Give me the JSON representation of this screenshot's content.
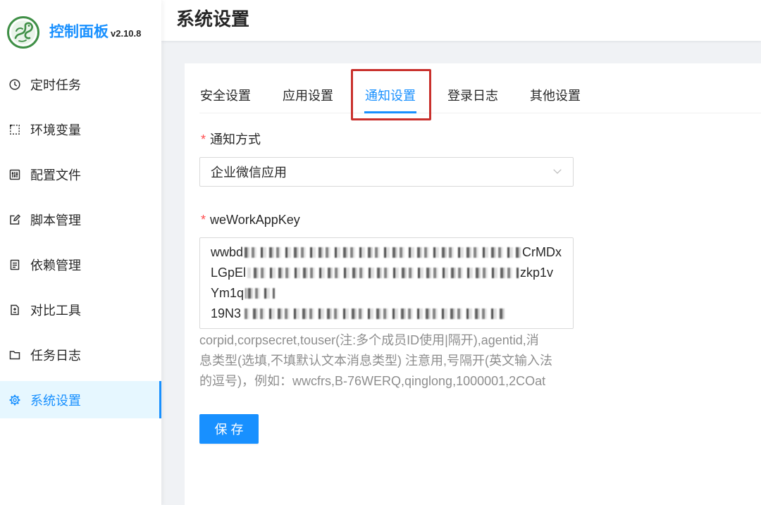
{
  "app": {
    "name": "控制面板",
    "version": "v2.10.8",
    "logo_icon": "dragon-logo-icon"
  },
  "colors": {
    "primary": "#1890ff",
    "selected_bg": "#e6f7ff",
    "page_bg": "#f0f2f5",
    "highlight": "#c9302c",
    "required": "#ff4d4f"
  },
  "sidebar": {
    "items": [
      {
        "label": "定时任务",
        "icon": "clock-icon",
        "selected": false
      },
      {
        "label": "环境变量",
        "icon": "dashed-box-icon",
        "selected": false
      },
      {
        "label": "配置文件",
        "icon": "control-panel-icon",
        "selected": false
      },
      {
        "label": "脚本管理",
        "icon": "edit-icon",
        "selected": false
      },
      {
        "label": "依赖管理",
        "icon": "file-text-icon",
        "selected": false
      },
      {
        "label": "对比工具",
        "icon": "diff-icon",
        "selected": false
      },
      {
        "label": "任务日志",
        "icon": "folder-icon",
        "selected": false
      },
      {
        "label": "系统设置",
        "icon": "gear-icon",
        "selected": true
      }
    ]
  },
  "header": {
    "title": "系统设置"
  },
  "settings": {
    "tabs": [
      {
        "label": "安全设置",
        "active": false
      },
      {
        "label": "应用设置",
        "active": false
      },
      {
        "label": "通知设置",
        "active": true,
        "annotated": true
      },
      {
        "label": "登录日志",
        "active": false
      },
      {
        "label": "其他设置",
        "active": false
      }
    ],
    "form": {
      "notify_type": {
        "required_mark": "*",
        "label": "通知方式",
        "value": "企业微信应用",
        "icon": "chevron-down-icon"
      },
      "app_key": {
        "required_mark": "*",
        "label": "weWorkAppKey",
        "value_lines": [
          {
            "start": "wwbd",
            "redacted": true,
            "end": "CrMDx"
          },
          {
            "start": "LGpEl",
            "redacted": true,
            "end": "zkp1v"
          },
          {
            "start": "Ym1q",
            "redacted": true
          },
          {
            "start": "19N3",
            "redacted": true
          }
        ],
        "help_lines": [
          "corpid,corpsecret,touser(注:多个成员ID使用|隔开),agentid,消",
          "息类型(选填,不填默认文本消息类型) 注意用,号隔开(英文输入法",
          "的逗号)，例如：wwcfrs,B-76WERQ,qinglong,1000001,2COat"
        ]
      },
      "save_label": "保 存"
    }
  }
}
